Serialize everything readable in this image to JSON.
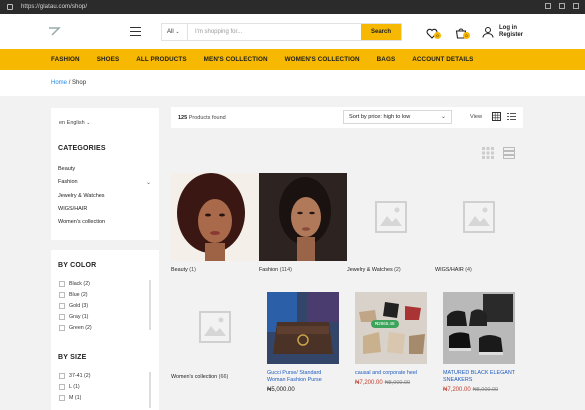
{
  "browser": {
    "url": "https://glatau.com/shop/"
  },
  "header": {
    "search_category": "All",
    "search_placeholder": "I'm shopping for...",
    "search_button": "Search",
    "wishlist_count": "0",
    "cart_count": "0",
    "login_line1": "Log in",
    "login_line2": "Register"
  },
  "nav": {
    "items": [
      "FASHION",
      "SHOES",
      "ALL PRODUCTS",
      "MEN'S COLLECTION",
      "WOMEN'S COLLECTION",
      "BAGS",
      "ACCOUNT DETAILS"
    ]
  },
  "breadcrumb": {
    "home": "Home",
    "sep": "/",
    "current": "Shop"
  },
  "sidebar": {
    "lang": "en  English",
    "categories_title": "CATEGORIES",
    "categories": [
      "Beauty",
      "Fashion",
      "Jewelry & Watches",
      "WIGS/HAIR",
      "Women's collection"
    ],
    "color_title": "BY COLOR",
    "colors": [
      "Black (2)",
      "Blue (2)",
      "Gold (3)",
      "Gray (1)",
      "Green (2)"
    ],
    "size_title": "BY SIZE",
    "sizes": [
      "37-41 (2)",
      "L (1)",
      "M (1)"
    ]
  },
  "toolbar": {
    "count_num": "125",
    "count_text": "Products found",
    "sort": "Sort by price: high to low",
    "view": "View"
  },
  "category_tiles": [
    {
      "name": "Beauty",
      "count": "(1)"
    },
    {
      "name": "Fashion",
      "count": "(114)"
    },
    {
      "name": "Jewelry & Watches",
      "count": "(2)"
    },
    {
      "name": "WIGS/HAIR",
      "count": "(4)"
    },
    {
      "name": "Women's collection",
      "count": "(66)"
    }
  ],
  "products": [
    {
      "title": "Gucci Purse/ Standard Woman Fashion Purse",
      "price": "₦5,000.00",
      "old": ""
    },
    {
      "title": "causal and corporate heel",
      "price": "₦7,200.00",
      "old": "₦8,000.00",
      "tag": "₦2865.48"
    },
    {
      "title": "MATURED BLACK ELEGANT SNEAKERS",
      "price": "₦7,200.00",
      "old": "₦8,000.00"
    }
  ],
  "colors": {
    "accent": "#f6b800",
    "link": "#1e5bbf",
    "sale": "#c0392b"
  }
}
